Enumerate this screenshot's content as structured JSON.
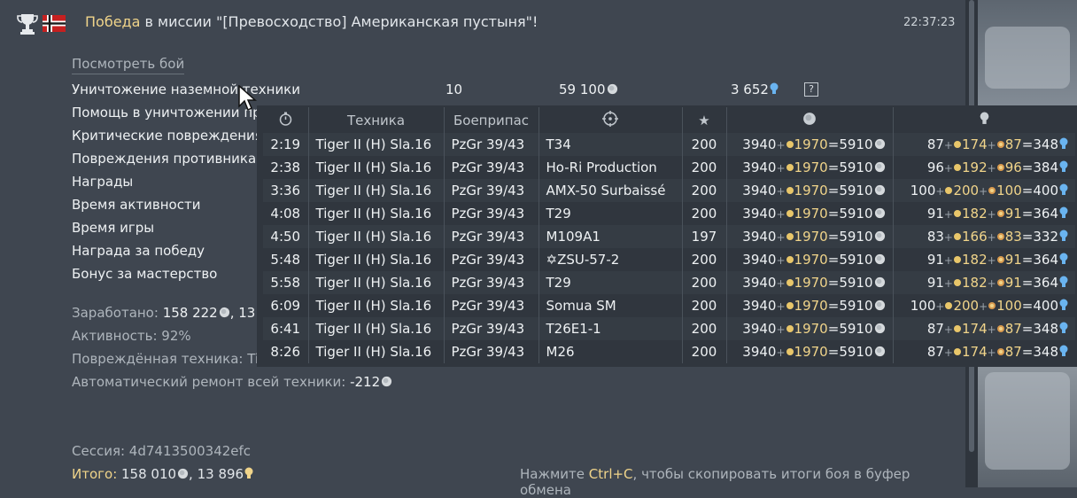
{
  "header": {
    "victory": "Победа",
    "mission_text": " в миссии \"[Превосходство] Американская пустыня\"!",
    "time": "22:37:23"
  },
  "link": "Посмотреть бой",
  "rows": [
    "Уничтожение наземной техники",
    "Помощь в уничтожении пр",
    "Критические повреждения",
    "Повреждения противника",
    "Награды",
    "Время активности",
    "Время игры",
    "Награда за победу",
    "Бонус за мастерство"
  ],
  "row1_values": {
    "count": "10",
    "silver": "59 100",
    "rp": "3 652"
  },
  "table": {
    "headers": {
      "time_icon": "stopwatch-icon",
      "vehicle": "Техника",
      "ammo": "Боеприпас",
      "target_icon": "crosshair-icon",
      "score_icon": "star-icon",
      "silver_icon": "lion-icon",
      "rp_icon": "bulb-icon"
    },
    "rows": [
      {
        "time": "2:19",
        "vehicle": "Tiger II (H) Sla.16",
        "ammo": "PzGr 39/43",
        "target": "T34",
        "score": "200",
        "s_base": "3940",
        "s_bonus": "1970",
        "s_total": "5910",
        "r_base": "87",
        "r_b1": "174",
        "r_b2": "87",
        "r_total": "348"
      },
      {
        "time": "2:38",
        "vehicle": "Tiger II (H) Sla.16",
        "ammo": "PzGr 39/43",
        "target": "Ho-Ri Production",
        "score": "200",
        "s_base": "3940",
        "s_bonus": "1970",
        "s_total": "5910",
        "r_base": "96",
        "r_b1": "192",
        "r_b2": "96",
        "r_total": "384"
      },
      {
        "time": "3:36",
        "vehicle": "Tiger II (H) Sla.16",
        "ammo": "PzGr 39/43",
        "target": "AMX-50 Surbaissé",
        "score": "200",
        "s_base": "3940",
        "s_bonus": "1970",
        "s_total": "5910",
        "r_base": "100",
        "r_b1": "200",
        "r_b2": "100",
        "r_total": "400"
      },
      {
        "time": "4:08",
        "vehicle": "Tiger II (H) Sla.16",
        "ammo": "PzGr 39/43",
        "target": "T29",
        "score": "200",
        "s_base": "3940",
        "s_bonus": "1970",
        "s_total": "5910",
        "r_base": "91",
        "r_b1": "182",
        "r_b2": "91",
        "r_total": "364"
      },
      {
        "time": "4:50",
        "vehicle": "Tiger II (H) Sla.16",
        "ammo": "PzGr 39/43",
        "target": "M109A1",
        "score": "197",
        "s_base": "3940",
        "s_bonus": "1970",
        "s_total": "5910",
        "r_base": "83",
        "r_b1": "166",
        "r_b2": "83",
        "r_total": "332"
      },
      {
        "time": "5:48",
        "vehicle": "Tiger II (H) Sla.16",
        "ammo": "PzGr 39/43",
        "target": "✡ZSU-57-2",
        "score": "200",
        "s_base": "3940",
        "s_bonus": "1970",
        "s_total": "5910",
        "r_base": "91",
        "r_b1": "182",
        "r_b2": "91",
        "r_total": "364"
      },
      {
        "time": "5:58",
        "vehicle": "Tiger II (H) Sla.16",
        "ammo": "PzGr 39/43",
        "target": "T29",
        "score": "200",
        "s_base": "3940",
        "s_bonus": "1970",
        "s_total": "5910",
        "r_base": "91",
        "r_b1": "182",
        "r_b2": "91",
        "r_total": "364"
      },
      {
        "time": "6:09",
        "vehicle": "Tiger II (H) Sla.16",
        "ammo": "PzGr 39/43",
        "target": "Somua SM",
        "score": "200",
        "s_base": "3940",
        "s_bonus": "1970",
        "s_total": "5910",
        "r_base": "100",
        "r_b1": "200",
        "r_b2": "100",
        "r_total": "400"
      },
      {
        "time": "6:41",
        "vehicle": "Tiger II (H) Sla.16",
        "ammo": "PzGr 39/43",
        "target": "T26E1-1",
        "score": "200",
        "s_base": "3940",
        "s_bonus": "1970",
        "s_total": "5910",
        "r_base": "87",
        "r_b1": "174",
        "r_b2": "87",
        "r_total": "348"
      },
      {
        "time": "8:26",
        "vehicle": "Tiger II (H) Sla.16",
        "ammo": "PzGr 39/43",
        "target": "M26",
        "score": "200",
        "s_base": "3940",
        "s_bonus": "1970",
        "s_total": "5910",
        "r_base": "87",
        "r_b1": "174",
        "r_b2": "87",
        "r_total": "348"
      }
    ]
  },
  "summary": {
    "earned_label": "Заработано: ",
    "earned_value": "158 222",
    "earned_tail": ", 13",
    "activity": "Активность: 92%",
    "damaged": "Повреждённая техника: Ti",
    "repair_label": "Автоматический ремонт всей техники: ",
    "repair_value": "-212",
    "session": "Сессия: 4d7413500342efc",
    "total_label": "Итого:",
    "total_silver": " 158 010",
    "total_rp": ", 13 896"
  },
  "hint": {
    "pre": "Нажмите ",
    "key": "Ctrl+C",
    "post": ", чтобы скопировать итоги боя в буфер обмена"
  },
  "colors": {
    "accent_gold": "#f0d48a",
    "background": "#3f4650",
    "popup": "#30363e"
  }
}
